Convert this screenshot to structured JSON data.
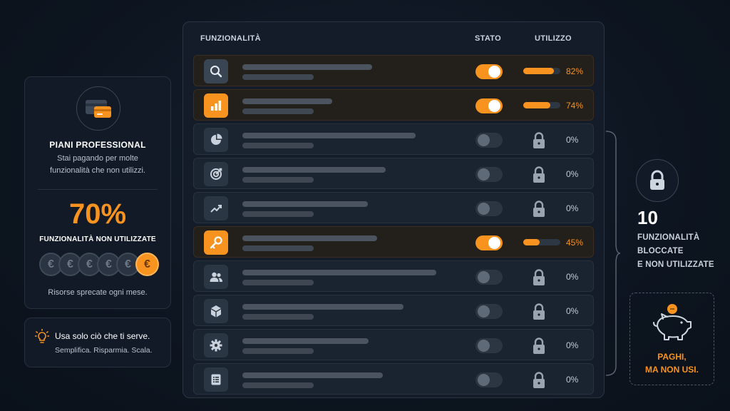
{
  "plan": {
    "title": "PIANI PROFESSIONAL",
    "description": "Stai pagando per molte funzionalità che non utilizzi.",
    "unused_percent": "70%",
    "unused_label": "FUNZIONALITÀ NON UTILIZZATE",
    "coin_symbol": "€",
    "coins_total": 6,
    "coins_active": 1,
    "waste_text": "Risorse sprecate ogni mese."
  },
  "tip": {
    "title": "Usa solo ciò che ti serve.",
    "subtitle": "Semplifica. Risparmia. Scala."
  },
  "table": {
    "headers": {
      "feature": "FUNZIONALITÀ",
      "status": "STATO",
      "usage": "UTILIZZO"
    },
    "rows": [
      {
        "icon": "search-icon",
        "enabled": true,
        "usage": 0.82,
        "usage_label": "82%"
      },
      {
        "icon": "bar-chart-icon",
        "enabled": true,
        "usage": 0.74,
        "usage_label": "74%"
      },
      {
        "icon": "pie-chart-icon",
        "enabled": false,
        "usage": 0,
        "usage_label": "0%"
      },
      {
        "icon": "target-icon",
        "enabled": false,
        "usage": 0,
        "usage_label": "0%"
      },
      {
        "icon": "trend-up-icon",
        "enabled": false,
        "usage": 0,
        "usage_label": "0%"
      },
      {
        "icon": "key-icon",
        "enabled": true,
        "usage": 0.45,
        "usage_label": "45%"
      },
      {
        "icon": "users-icon",
        "enabled": false,
        "usage": 0,
        "usage_label": "0%"
      },
      {
        "icon": "cube-icon",
        "enabled": false,
        "usage": 0,
        "usage_label": "0%"
      },
      {
        "icon": "gear-icon",
        "enabled": false,
        "usage": 0,
        "usage_label": "0%"
      },
      {
        "icon": "document-icon",
        "enabled": false,
        "usage": 0,
        "usage_label": "0%"
      }
    ]
  },
  "blocked": {
    "count": "10",
    "line1": "FUNZIONALITÀ",
    "line2": "BLOCCATE",
    "line3": "E NON UTILIZZATE"
  },
  "pay": {
    "line1": "PAGHI,",
    "line2": "MA NON USI."
  },
  "colors": {
    "accent": "#f7931e",
    "background": "#0d1520",
    "card": "#111a26"
  }
}
